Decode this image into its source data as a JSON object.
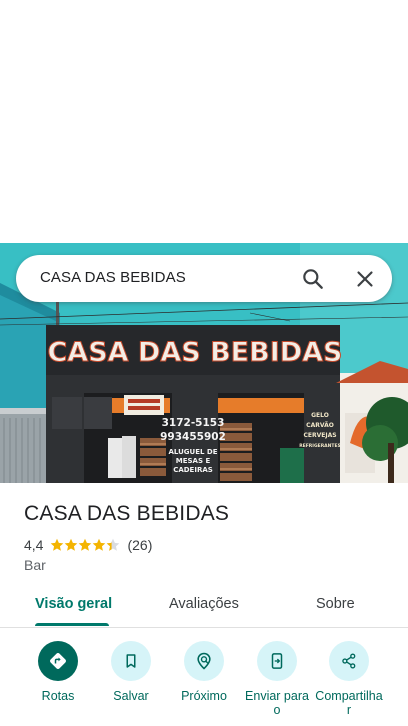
{
  "search": {
    "query": "CASA DAS BEBIDAS"
  },
  "photo": {
    "sign_text": "CASA DAS BEBIDAS",
    "phone_1": "3172-5153",
    "phone_2": "993455902",
    "rental_text_1": "ALUGUEL DE",
    "rental_text_2": "MESAS E",
    "rental_text_3": "CADEIRAS",
    "side_text_1": "GELO",
    "side_text_2": "CARVÃO",
    "side_text_3": "CERVEJAS",
    "side_text_4": "REFRIGERANTES"
  },
  "place": {
    "name": "CASA DAS BEBIDAS",
    "rating": "4,4",
    "rating_value": 4.4,
    "rating_max": 5,
    "review_count": "(26)",
    "category": "Bar"
  },
  "tabs": [
    {
      "label": "Visão geral",
      "active": true
    },
    {
      "label": "Avaliações",
      "active": false
    },
    {
      "label": "Sobre",
      "active": false
    }
  ],
  "actions": [
    {
      "label": "Rotas",
      "icon": "directions-icon",
      "primary": true
    },
    {
      "label": "Salvar",
      "icon": "bookmark-icon",
      "primary": false
    },
    {
      "label": "Próximo",
      "icon": "nearby-icon",
      "primary": false
    },
    {
      "label": "Enviar para o",
      "icon": "send-to-phone-icon",
      "primary": false
    },
    {
      "label": "Compartilhar",
      "icon": "share-icon",
      "primary": false
    }
  ],
  "colors": {
    "accent": "#00796b",
    "action_bg": "#d6f4f8",
    "star": "#f4b400"
  }
}
